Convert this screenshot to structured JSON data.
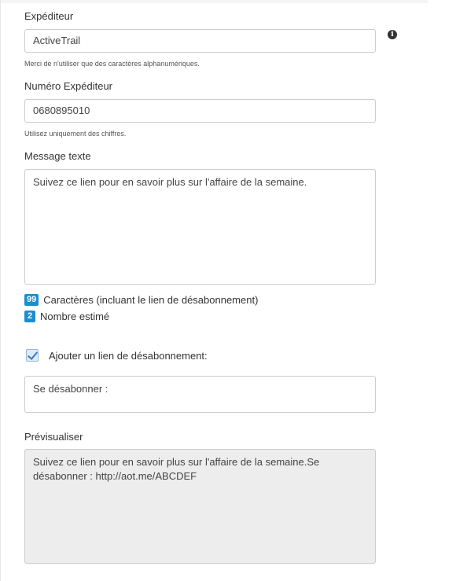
{
  "sender": {
    "label": "Expéditeur",
    "value": "ActiveTrail",
    "help": "Merci de n'utiliser que des caractères alphanumériques.",
    "info_icon": "info-icon"
  },
  "sender_number": {
    "label": "Numéro Expéditeur",
    "value": "0680895010",
    "help": "Utilisez uniquement des chiffres."
  },
  "message": {
    "label": "Message texte",
    "value": "Suivez ce lien pour en savoir plus sur l'affaire de la semaine."
  },
  "counters": {
    "chars_count": "99",
    "chars_label": "Caractères (incluant le lien de désabonnement)",
    "estimate_count": "2",
    "estimate_label": "Nombre estimé",
    "badge_color": "#1b8dd1"
  },
  "unsubscribe": {
    "checked": true,
    "label": "Ajouter un lien de désabonnement:",
    "value": "Se désabonner :"
  },
  "preview": {
    "label": "Prévisualiser",
    "value": "Suivez ce lien pour en savoir plus sur l'affaire de la semaine.Se désabonner : http://aot.me/ABCDEF"
  }
}
